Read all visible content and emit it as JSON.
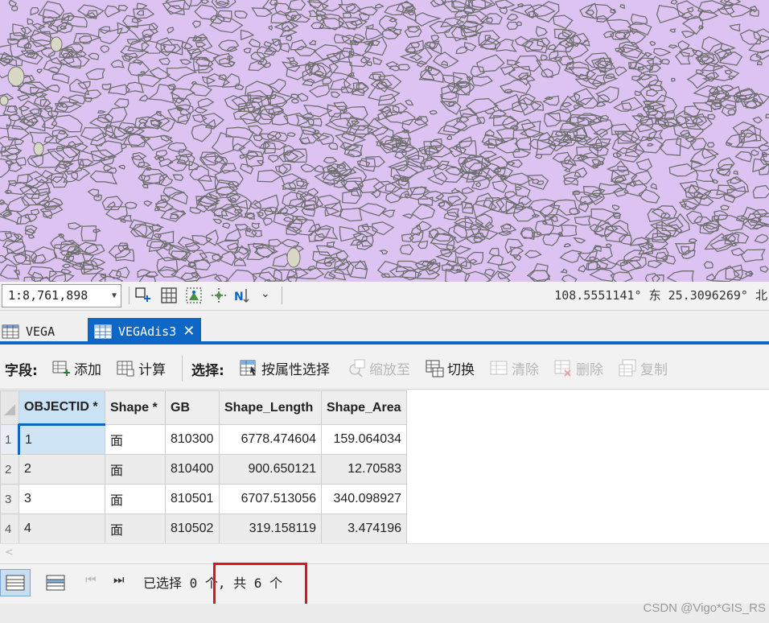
{
  "map_colors": {
    "fill": "#dcc3f2",
    "boundary": "#6f6f6f",
    "gap": "#d8d8c4"
  },
  "statusbar": {
    "scale": "1:8,761,898",
    "coordinates": "108.5551141° 东 25.3096269° 北"
  },
  "tabs": [
    {
      "label": "VEGA",
      "active": false
    },
    {
      "label": "VEGAdis3",
      "active": true
    }
  ],
  "toolbar": {
    "field_label": "字段:",
    "add_label": "添加",
    "calc_label": "计算",
    "select_label": "选择:",
    "by_attr_label": "按属性选择",
    "zoom_to_label": "缩放至",
    "switch_label": "切换",
    "clear_label": "清除",
    "delete_label": "删除",
    "copy_label": "复制"
  },
  "table": {
    "columns": [
      "OBJECTID *",
      "Shape *",
      "GB",
      "Shape_Length",
      "Shape_Area"
    ],
    "rows": [
      [
        "1",
        "1",
        "面",
        "810300",
        "6778.474604",
        "159.064034"
      ],
      [
        "2",
        "2",
        "面",
        "810400",
        "900.650121",
        "12.70583"
      ],
      [
        "3",
        "3",
        "面",
        "810501",
        "6707.513056",
        "340.098927"
      ],
      [
        "4",
        "4",
        "面",
        "810502",
        "319.158119",
        "3.474196"
      ]
    ]
  },
  "footer": {
    "selection_text": "已选择 0 个, 共 6 个"
  },
  "watermark": "CSDN @Vigo*GIS_RS",
  "accent_color": "#0e67c4",
  "highlight_color": "#e0141e"
}
